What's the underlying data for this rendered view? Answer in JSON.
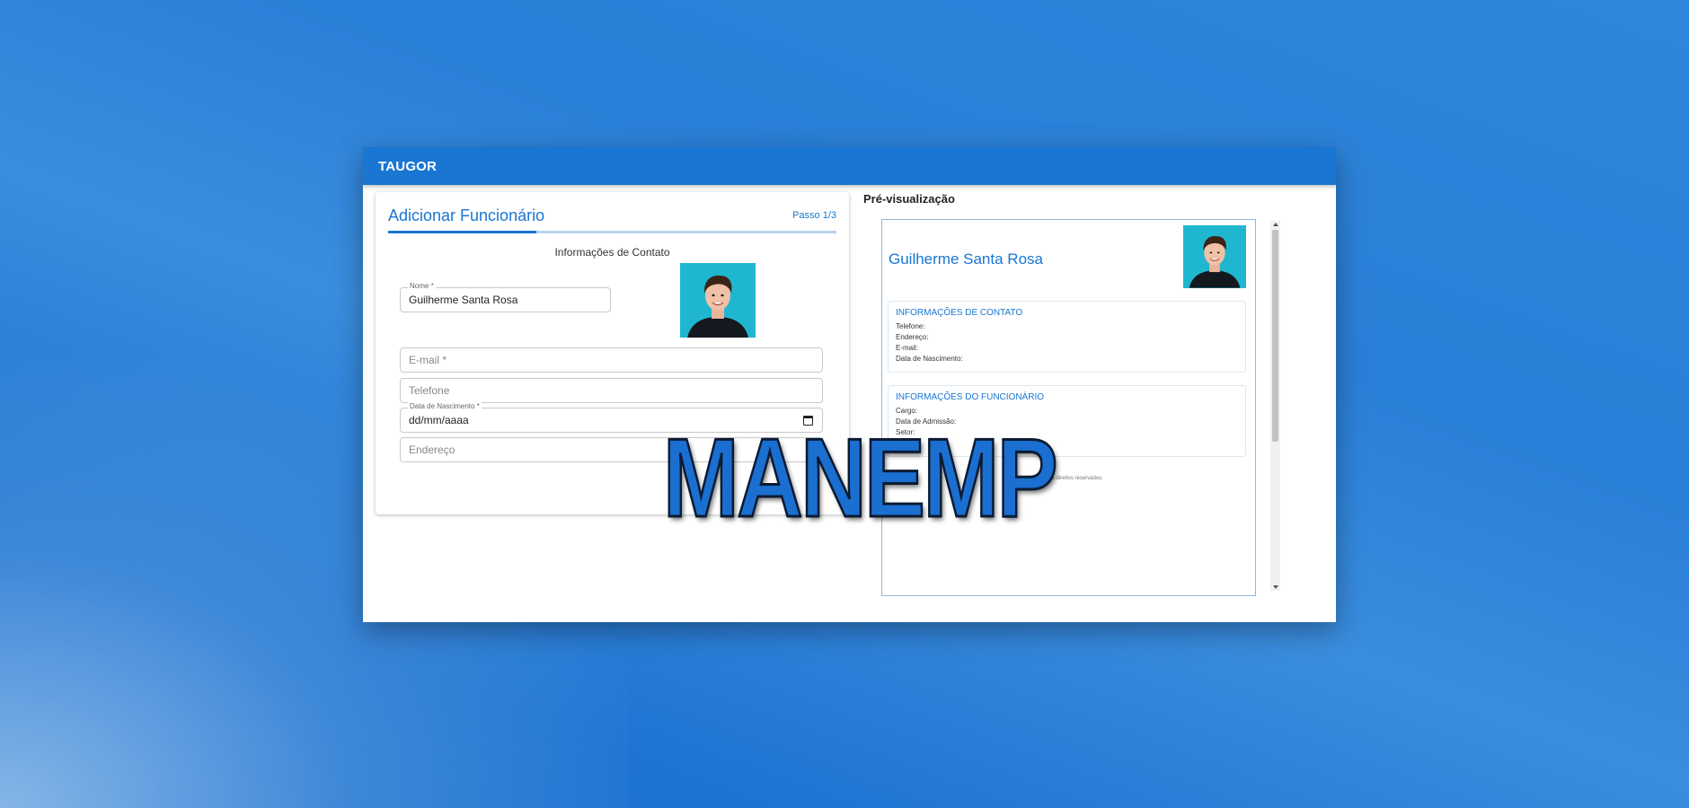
{
  "app": {
    "title": "TAUGOR"
  },
  "form": {
    "title": "Adicionar Funcionário",
    "step": "Passo 1/3",
    "progress_fraction": 0.33,
    "section_title": "Informações de Contato",
    "fields": {
      "name": {
        "label": "Nome *",
        "value": "Guilherme Santa Rosa"
      },
      "email": {
        "placeholder": "E-mail *"
      },
      "phone": {
        "placeholder": "Telefone"
      },
      "birthdate": {
        "label": "Data de Nascimento *",
        "value": "dd/mm/aaaa",
        "icon": "calendar-icon"
      },
      "address": {
        "placeholder": "Endereço"
      }
    }
  },
  "preview": {
    "label": "Pré-visualização",
    "name": "Guilherme Santa Rosa",
    "contact_section": {
      "title": "INFORMAÇÕES DE CONTATO",
      "lines": [
        "Telefone:",
        "Endereço:",
        "E-mail:",
        "Data de Nascimento:"
      ]
    },
    "employee_section": {
      "title": "INFORMAÇÕES DO FUNCIONÁRIO",
      "lines": [
        "Cargo:",
        "Data de Admissão:",
        "Setor:"
      ]
    },
    "footer": "todos os direitos reservados."
  },
  "watermark": {
    "text": "MANEMP"
  },
  "colors": {
    "primary": "#1976d2",
    "background": "#2a7fd8",
    "photo_background": "#1fb7cf",
    "watermark_outline": "#0b1b33"
  }
}
